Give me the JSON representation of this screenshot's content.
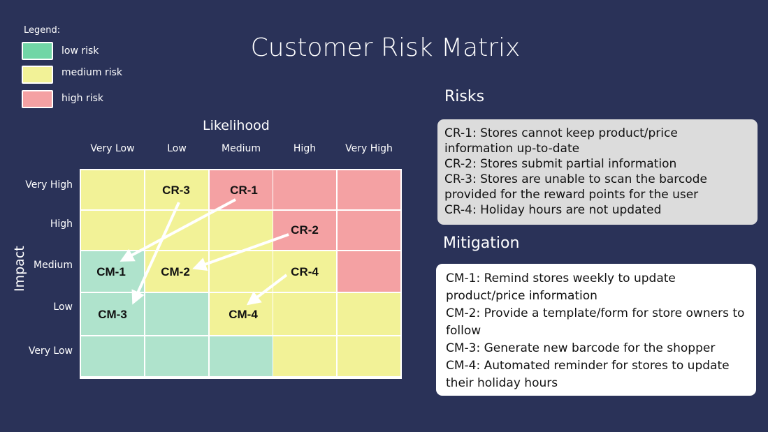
{
  "title": "Customer Risk Matrix",
  "legend": {
    "title": "Legend:",
    "items": [
      {
        "label": "low risk",
        "color": "#71d6a6"
      },
      {
        "label": "medium risk",
        "color": "#f2f297"
      },
      {
        "label": "high risk",
        "color": "#f4a1a3"
      }
    ]
  },
  "matrix": {
    "x_title": "Likelihood",
    "y_title": "Impact",
    "columns": [
      "Very Low",
      "Low",
      "Medium",
      "High",
      "Very High"
    ],
    "rows": [
      "Very High",
      "High",
      "Medium",
      "Low",
      "Very Low"
    ],
    "levels": [
      [
        "medium",
        "medium",
        "high",
        "high",
        "high"
      ],
      [
        "medium",
        "medium",
        "medium",
        "high",
        "high"
      ],
      [
        "low",
        "medium",
        "medium",
        "medium",
        "high"
      ],
      [
        "low",
        "low",
        "medium",
        "medium",
        "medium"
      ],
      [
        "low",
        "low",
        "low",
        "medium",
        "medium"
      ]
    ],
    "colors": {
      "low": "#afe3cc",
      "medium": "#f2f297",
      "high": "#f4a1a3"
    },
    "labels": {
      "cr1": "CR-1",
      "cr2": "CR-2",
      "cr3": "CR-3",
      "cr4": "CR-4",
      "cm1": "CM-1",
      "cm2": "CM-2",
      "cm3": "CM-3",
      "cm4": "CM-4"
    },
    "arrows": [
      {
        "from": "CR-1",
        "to": "CM-1"
      },
      {
        "from": "CR-2",
        "to": "CM-2"
      },
      {
        "from": "CR-3",
        "to": "CM-3"
      },
      {
        "from": "CR-4",
        "to": "CM-4"
      }
    ]
  },
  "risks": {
    "heading": "Risks",
    "lines": [
      "CR-1: Stores cannot keep product/price",
      "information up-to-date",
      "CR-2: Stores submit partial information",
      "CR-3: Stores are unable to scan the barcode",
      "provided for the reward points for the user",
      "CR-4: Holiday hours are not updated"
    ]
  },
  "mitigation": {
    "heading": "Mitigation",
    "lines": [
      "CM-1: Remind stores weekly to update",
      "product/price information",
      "CM-2: Provide a template/form for store owners to",
      "follow",
      "CM-3: Generate new barcode for the shopper",
      "CM-4: Automated reminder for stores to update",
      "their holiday hours"
    ]
  }
}
